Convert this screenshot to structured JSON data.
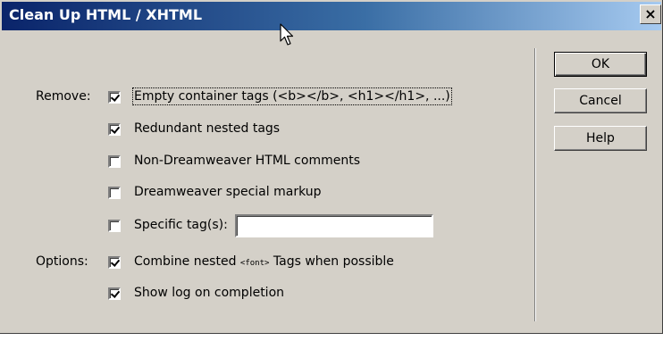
{
  "window": {
    "title": "Clean Up HTML / XHTML",
    "close_label": "×"
  },
  "remove": {
    "label": "Remove:",
    "items": [
      {
        "label": "Empty container tags (<b></b>, <h1></h1>, ...)",
        "checked": true
      },
      {
        "label": "Redundant nested tags",
        "checked": true
      },
      {
        "label": "Non-Dreamweaver HTML comments",
        "checked": false
      },
      {
        "label": "Dreamweaver special markup",
        "checked": false
      },
      {
        "label": "Specific tag(s):",
        "checked": false
      }
    ],
    "specific_tags_value": ""
  },
  "options": {
    "label": "Options:",
    "combine_prefix": "Combine nested",
    "combine_code": "<font>",
    "combine_suffix": "Tags when possible",
    "combine_checked": true,
    "show_log_label": "Show log on completion",
    "show_log_checked": true
  },
  "buttons": {
    "ok": "OK",
    "cancel": "Cancel",
    "help": "Help"
  }
}
